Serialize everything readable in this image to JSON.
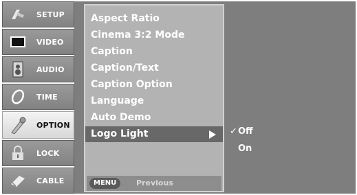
{
  "tabs": [
    {
      "label": "SETUP",
      "icon": "setup-icon"
    },
    {
      "label": "VIDEO",
      "icon": "video-icon"
    },
    {
      "label": "AUDIO",
      "icon": "audio-icon"
    },
    {
      "label": "TIME",
      "icon": "time-icon"
    },
    {
      "label": "OPTION",
      "icon": "option-icon",
      "active": true
    },
    {
      "label": "LOCK",
      "icon": "lock-icon"
    },
    {
      "label": "CABLE",
      "icon": "cable-icon"
    }
  ],
  "menu": {
    "items": [
      "Aspect Ratio",
      "Cinema 3:2 Mode",
      "Caption",
      "Caption/Text",
      "Caption Option",
      "Language",
      "Auto Demo",
      "Logo Light"
    ],
    "selected": "Logo Light"
  },
  "footer": {
    "menu_key": "MENU",
    "previous": "Previous"
  },
  "submenu": {
    "options": [
      "Off",
      "On"
    ],
    "checked": "Off",
    "check_mark": "✓"
  },
  "colors": {
    "background": "#7e7e7e",
    "panel": "#b3b3b3",
    "selected_row": "#686868"
  }
}
